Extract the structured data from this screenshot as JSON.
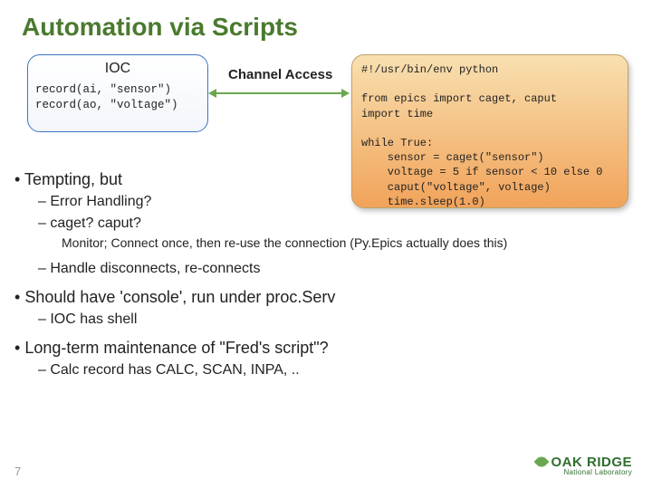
{
  "title": "Automation via Scripts",
  "ioc": {
    "header": "IOC",
    "line1": "record(ai, \"sensor\")",
    "line2": "record(ao, \"voltage\")"
  },
  "channel_access": "Channel Access",
  "python_script": "#!/usr/bin/env python\n\nfrom epics import caget, caput\nimport time\n\nwhile True:\n    sensor = caget(\"sensor\")\n    voltage = 5 if sensor < 10 else 0\n    caput(\"voltage\", voltage)\n    time.sleep(1.0)",
  "bullets": {
    "b1": "Tempting, but",
    "b1a": "Error Handling?",
    "b1b": "caget? caput?",
    "b1b_note": "Monitor; Connect once, then re-use the connection (Py.Epics actually does this)",
    "b1c": "Handle disconnects, re-connects",
    "b2": "Should have 'console', run under proc.Serv",
    "b2a": "IOC has shell",
    "b3": "Long-term maintenance of \"Fred's script\"?",
    "b3a": "Calc record has CALC, SCAN, INPA, .."
  },
  "page_number": "7",
  "logo": {
    "main": "OAK RIDGE",
    "sub": "National Laboratory"
  }
}
